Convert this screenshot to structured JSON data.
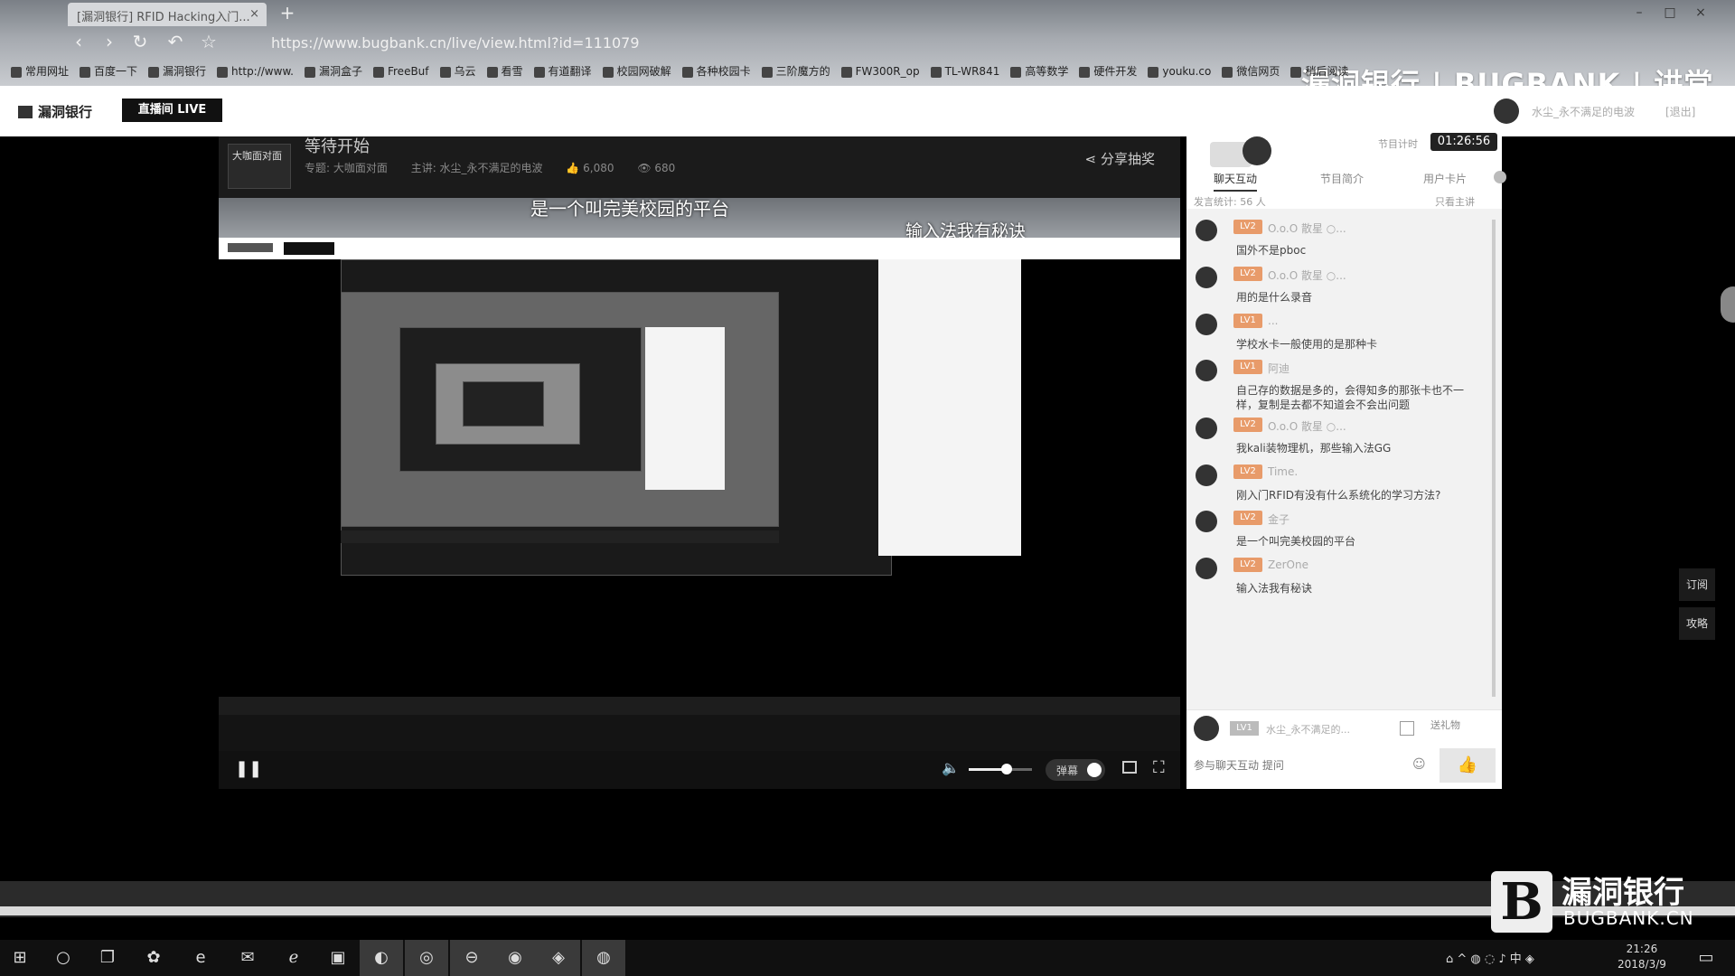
{
  "browser": {
    "tab_title": "[漏洞银行] RFID Hacking入门...",
    "new_tab": "+",
    "address": "https://www.bugbank.cn/live/view.html?id=111079",
    "brand_banner": "漏洞银行 | BUGBANK | 讲堂",
    "bookmarks": [
      "常用网址",
      "百度一下",
      "漏洞银行",
      "http://www.",
      "漏洞盒子",
      "FreeBuf",
      "乌云",
      "看雪",
      "有道翻译",
      "校园网破解",
      "各种校园卡",
      "三阶魔方的",
      "FW300R_op",
      "TL-WR841",
      "高等数学",
      "硬件开发",
      "youku.co",
      "微信网页",
      "稍后阅读"
    ]
  },
  "site": {
    "logo": "漏洞银行",
    "live_button": "直播间 LIVE",
    "user_name": "水尘_永不满足的电波",
    "logout": "[退出]"
  },
  "stream": {
    "channel_avatar": "大咖面对面",
    "title": "等待开始",
    "meta": [
      "专题: 大咖面对面",
      "主讲: 水尘_永不满足的电波",
      "👍 6,080",
      "👁 680"
    ],
    "share": "分享抽奖"
  },
  "video": {
    "caption1": "是一个叫完美校园的平台",
    "caption2": "输入法我有秘诀"
  },
  "controls": {
    "pause": "❚❚",
    "volume_icon": "🔈",
    "volume_level": 0.6,
    "danmaku": "弹幕",
    "fullscreen": "⛶"
  },
  "chat": {
    "timer_label": "节目计时",
    "timer": "01:26:56",
    "tabs": [
      "聊天互动",
      "节目简介",
      "用户卡片"
    ],
    "stats": "发言统计: 56 人",
    "only_host": "只看主讲",
    "messages": [
      {
        "level": "LV2",
        "nick": "O.o.O 散星 ○...",
        "text": "国外不是pboc"
      },
      {
        "level": "LV2",
        "nick": "O.o.O 散星 ○...",
        "text": "用的是什么录音"
      },
      {
        "level": "LV1",
        "nick": "...",
        "text": "学校水卡一般使用的是那种卡"
      },
      {
        "level": "LV1",
        "nick": "阿迪",
        "text": "自己存的数据是多的，会得知多的那张卡也不一样，复制是去都不知道会不会出问题"
      },
      {
        "level": "LV2",
        "nick": "O.o.O 散星 ○...",
        "text": "我kali装物理机，那些输入法GG"
      },
      {
        "level": "LV2",
        "nick": "Time.",
        "text": "刚入门RFID有没有什么系统化的学习方法?"
      },
      {
        "level": "LV2",
        "nick": "金子",
        "text": "是一个叫完美校园的平台"
      },
      {
        "level": "LV2",
        "nick": "ZerOne",
        "text": "输入法我有秘诀"
      }
    ],
    "my_level": "LV1",
    "my_name": "水尘_永不满足的...",
    "gift": "送礼物",
    "input_placeholder": "参与聊天互动 提问",
    "send": "👍"
  },
  "float": {
    "subscribe": "订阅",
    "guide": "攻略"
  },
  "watermark": {
    "mark": "B",
    "cn": "漏洞银行",
    "en": "BUGBANK.CN"
  },
  "taskbar": {
    "icons": [
      "⊞",
      "○",
      "❐",
      "✿",
      "e",
      "✉",
      "ℯ",
      "▣",
      "◐",
      "◎",
      "⊖",
      "◉",
      "◈",
      "◍"
    ],
    "tray": "⌂ ^ ◍ ◌ ♪ 中 ◈",
    "time": "21:26",
    "date": "2018/3/9"
  }
}
